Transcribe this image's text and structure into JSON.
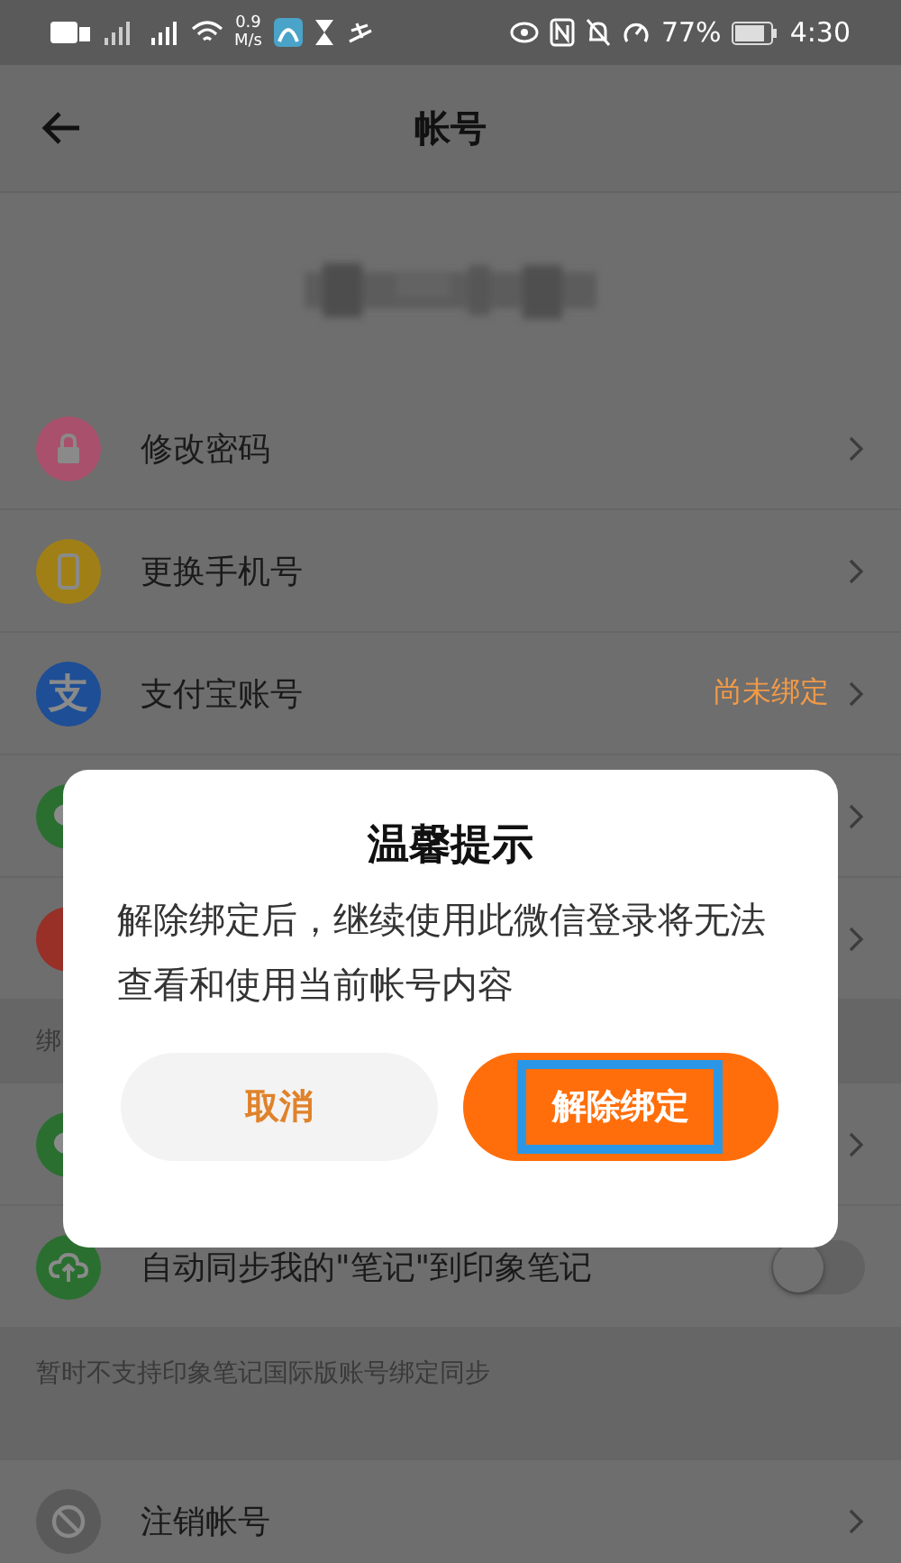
{
  "status_bar": {
    "speed_value": "0.9",
    "speed_unit": "M/s",
    "battery": "77%",
    "time": "4:30"
  },
  "header": {
    "title": "帐号"
  },
  "rows_top": [
    {
      "kind": "link",
      "color": "#a8506c",
      "label": "修改密码"
    },
    {
      "kind": "link",
      "color": "#a08016",
      "label": "更换手机号"
    },
    {
      "kind": "link",
      "glyph": "支",
      "color": "#1d4e96",
      "label": "支付宝账号",
      "value": "尚未绑定"
    },
    {
      "kind": "link",
      "color": "#2a6f30"
    },
    {
      "kind": "link",
      "color": "#983028"
    }
  ],
  "section_label": "绑",
  "rows_mid": [
    {
      "kind": "link",
      "color": "#2a6f30"
    },
    {
      "kind": "toggle",
      "color": "#2a6f30",
      "label": "自动同步我的\"笔记\"到印象笔记",
      "on": false
    }
  ],
  "note": "暂时不支持印象笔记国际版账号绑定同步",
  "rows_bottom": [
    {
      "kind": "link",
      "color": "#5a5a5a",
      "label": "注销帐号"
    }
  ],
  "dialog": {
    "title": "温馨提示",
    "message": "解除绑定后，继续使用此微信登录将无法查看和使用当前帐号内容",
    "buttons": [
      {
        "label": "取消",
        "kind": "secondary",
        "highlighted": false
      },
      {
        "label": "解除绑定",
        "kind": "primary",
        "highlighted": true
      }
    ]
  }
}
